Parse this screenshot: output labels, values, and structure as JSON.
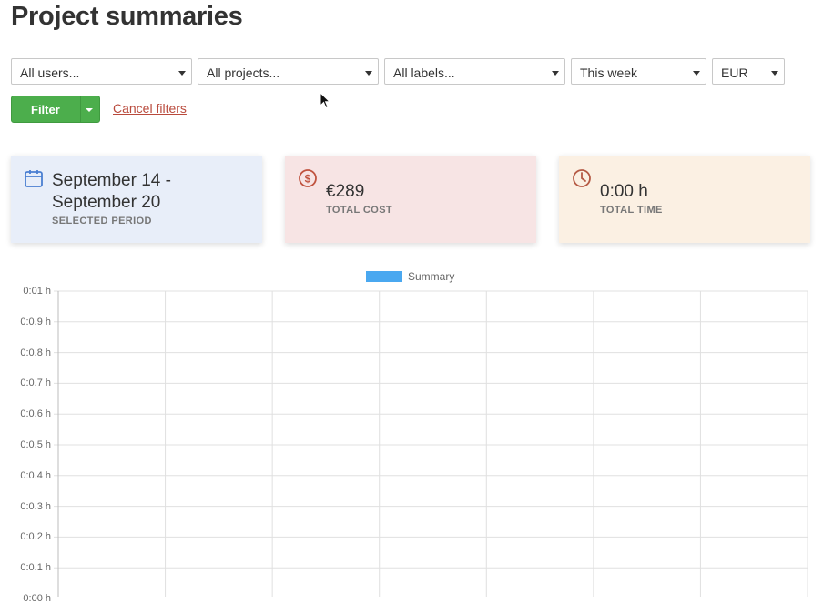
{
  "page": {
    "title": "Project summaries"
  },
  "filters": {
    "users": "All users...",
    "projects": "All projects...",
    "labels": "All labels...",
    "period": "This week",
    "currency": "EUR",
    "filter_label": "Filter",
    "cancel_label": "Cancel filters"
  },
  "cards": {
    "period": {
      "value_line1": "September 14 -",
      "value_line2": "September 20",
      "caption": "SELECTED PERIOD",
      "bg": "#e8eef9",
      "icon_color": "#4a7fd1",
      "icon": "calendar-icon"
    },
    "cost": {
      "value": "€289",
      "caption": "TOTAL COST",
      "bg": "#f7e4e4",
      "icon_color": "#c0533f",
      "icon": "dollar-circle-icon"
    },
    "time": {
      "value": "0:00 h",
      "caption": "TOTAL TIME",
      "bg": "#fbf0e3",
      "icon_color": "#b55a45",
      "icon": "clock-icon"
    }
  },
  "chart_data": {
    "type": "bar",
    "series": [
      {
        "name": "Summary",
        "values": [],
        "color": "#4aa8f0"
      }
    ],
    "categories": [
      "",
      "",
      "",
      "",
      "",
      "",
      ""
    ],
    "y_tick_labels": [
      "0:01 h",
      "0:0.9 h",
      "0:0.8 h",
      "0:0.7 h",
      "0:0.6 h",
      "0:0.5 h",
      "0:0.4 h",
      "0:0.3 h",
      "0:0.2 h",
      "0:0.1 h",
      "0:00 h"
    ],
    "ylim": [
      0,
      1
    ],
    "grid": true,
    "legend": "top-center"
  }
}
